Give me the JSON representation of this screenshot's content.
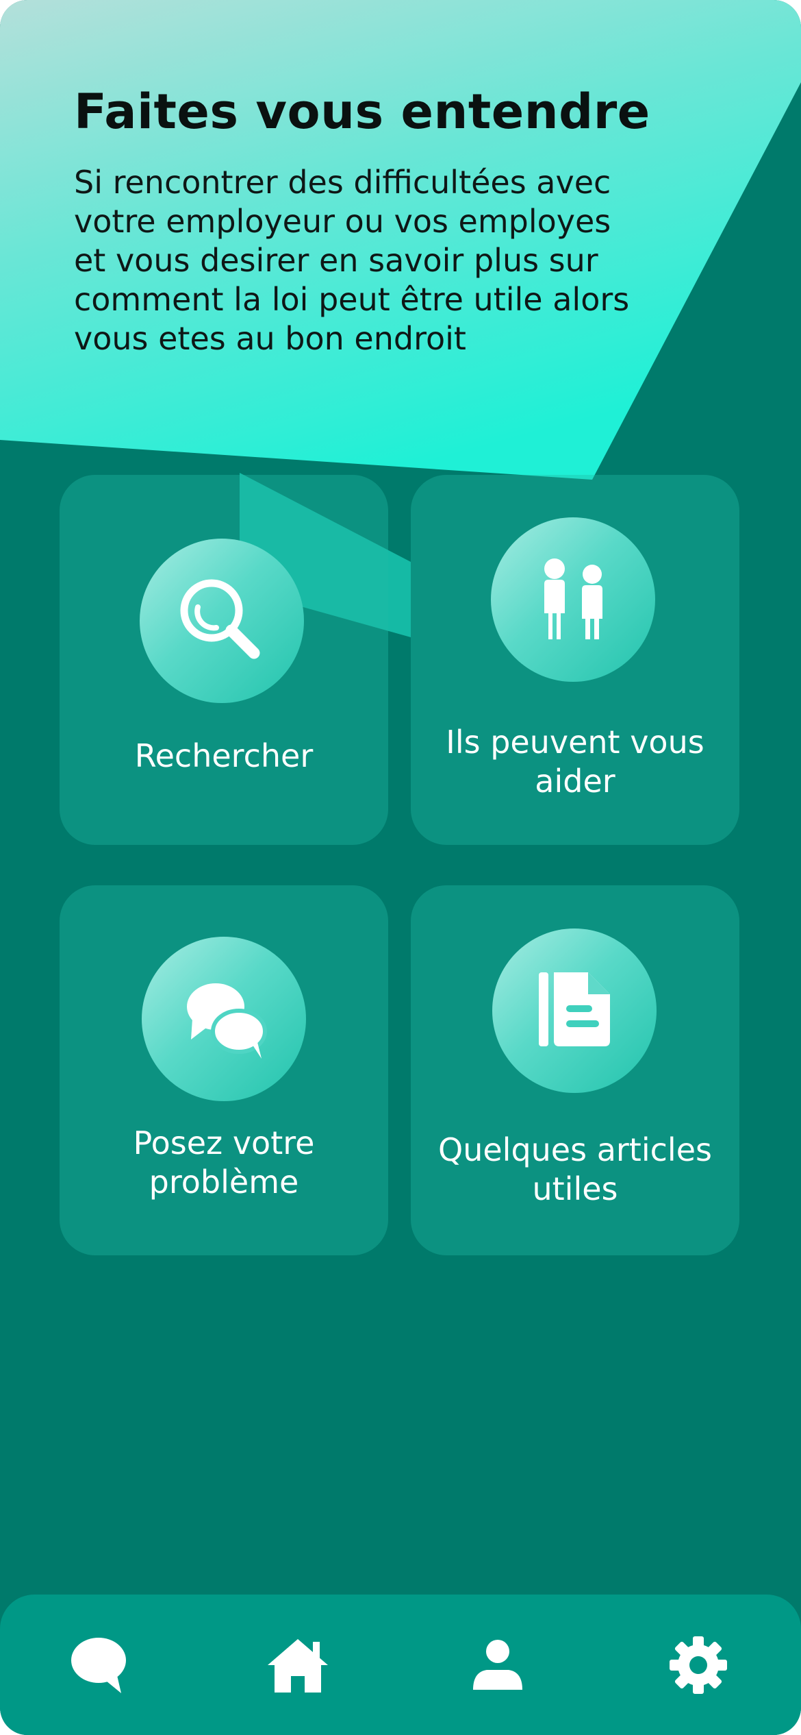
{
  "hero": {
    "title": "Faites vous entendre",
    "description_lines": [
      "Si rencontrer des difficultées avec",
      "votre employeur ou vos employes",
      "et vous desirer en savoir plus sur",
      "comment la loi peut être utile alors",
      "vous etes au bon endroit"
    ]
  },
  "cards": [
    {
      "label_lines": [
        "Rechercher"
      ],
      "icon": "search-icon"
    },
    {
      "label_lines": [
        "Ils peuvent vous",
        "aider"
      ],
      "icon": "people-icon"
    },
    {
      "label_lines": [
        "Posez votre",
        "problème"
      ],
      "icon": "chat-bubbles-icon"
    },
    {
      "label_lines": [
        "Quelques articles",
        "utiles"
      ],
      "icon": "document-icon"
    }
  ],
  "bottom_nav": [
    {
      "icon": "chat-icon"
    },
    {
      "icon": "home-icon"
    },
    {
      "icon": "profile-icon"
    },
    {
      "icon": "settings-icon"
    }
  ],
  "colors": {
    "background": "#007a6b",
    "hero_light": "#b4e2dc",
    "hero_bright": "#28f0d8",
    "card": "#13a390",
    "icon_circle": "#4ed6c4",
    "nav_bar": "#009886",
    "text_light": "#ffffff",
    "text_dark": "#0a1110"
  }
}
